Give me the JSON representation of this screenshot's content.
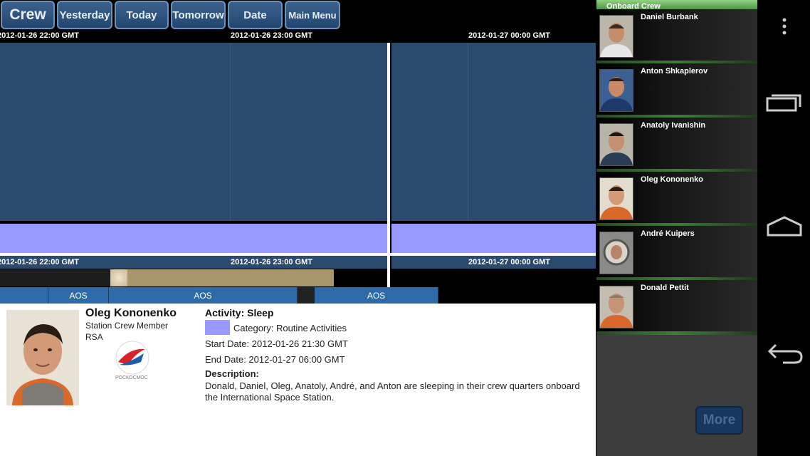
{
  "toolbar": {
    "crew": "Crew",
    "yesterday": "Yesterday",
    "today": "Today",
    "tomorrow": "Tomorrow",
    "date": "Date",
    "main_menu": "Main Menu"
  },
  "timeline": {
    "ticks": [
      "2012-01-26 22:00 GMT",
      "2012-01-26 23:00 GMT",
      "2012-01-27 00:00 GMT"
    ],
    "aos_label": "AOS"
  },
  "detail": {
    "name": "Oleg Kononenko",
    "role": "Station Crew Member",
    "agency": "RSA",
    "logo_text": "РОСКОСМОС",
    "activity": "Activity: Sleep",
    "category": "Category: Routine Activities",
    "category_color": "#9999ff",
    "start": "Start Date: 2012-01-26 21:30 GMT",
    "end": "End Date: 2012-01-27 06:00 GMT",
    "description_label": "Description:",
    "description": "Donald, Daniel, Oleg, Anatoly, André, and Anton are sleeping in their crew quarters onboard the International Space Station."
  },
  "sidebar": {
    "title": "Onboard Crew",
    "crew": [
      "Daniel Burbank",
      "Anton Shkaplerov",
      "Anatoly Ivanishin",
      "Oleg Kononenko",
      "André Kuipers",
      "Donald Pettit"
    ],
    "more": "More"
  },
  "colors": {
    "timeline_block": "#2b4b6e",
    "sleep_band": "#9999ff",
    "aos": "#2e6aa8",
    "toolbar": "#2d5580"
  },
  "icons": {
    "overflow": "overflow-menu-icon",
    "recents": "recent-apps-icon",
    "home": "home-icon",
    "back": "back-icon"
  }
}
